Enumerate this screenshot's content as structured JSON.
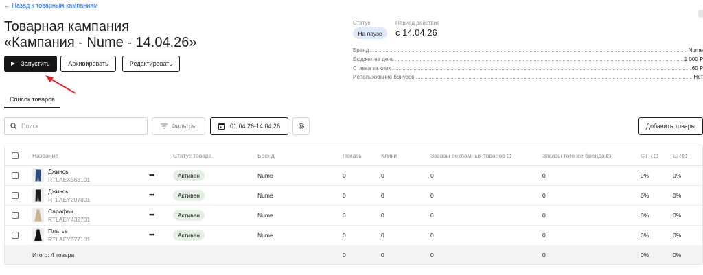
{
  "nav": {
    "back_label": "← Назад к товарным кампаниям"
  },
  "header": {
    "title_line1": "Товарная кампания",
    "title_line2": "«Кампания - Nume - 14.04.26»"
  },
  "actions": {
    "start_label": "Запустить",
    "archive_label": "Архивировать",
    "edit_label": "Редактировать"
  },
  "summary": {
    "status_label": "Статус",
    "status_value": "На паузе",
    "period_label": "Период действия",
    "period_value": "с 14.04.26",
    "rows": [
      {
        "label": "Бренд",
        "value": "Nume"
      },
      {
        "label": "Бюджет на день",
        "value": "1 000 ₽"
      },
      {
        "label": "Ставка за клик",
        "value": "60 ₽"
      },
      {
        "label": "Использование бонусов",
        "value": "Нет"
      }
    ]
  },
  "tabs": [
    {
      "label": "Список товаров",
      "active": true
    }
  ],
  "toolbar": {
    "search_placeholder": "Поиск",
    "filters_label": "Фильтры",
    "date_range": "01.04.26-14.04.26",
    "add_label": "Добавить товары"
  },
  "table": {
    "columns": [
      "Название",
      "Статус товара",
      "Бренд",
      "Показы",
      "Клики",
      "Заказы рекламных товаров",
      "Заказы того же бренда",
      "CTR",
      "CR"
    ],
    "rows": [
      {
        "name": "Джинсы",
        "sku": "RTLAEX563101",
        "status": "Активен",
        "brand": "Nume",
        "views": "0",
        "clicks": "0",
        "ads_orders": "0",
        "brand_orders": "0",
        "ctr": "0%",
        "cr": "0%",
        "thumb_color": "#2c4b7a"
      },
      {
        "name": "Джинсы",
        "sku": "RTLAEY207801",
        "status": "Активен",
        "brand": "Nume",
        "views": "0",
        "clicks": "0",
        "ads_orders": "0",
        "brand_orders": "0",
        "ctr": "0%",
        "cr": "0%",
        "thumb_color": "#1c1c1c"
      },
      {
        "name": "Сарафан",
        "sku": "RTLAEY432701",
        "status": "Активен",
        "brand": "Nume",
        "views": "0",
        "clicks": "0",
        "ads_orders": "0",
        "brand_orders": "0",
        "ctr": "0%",
        "cr": "0%",
        "thumb_color": "#c9b48a"
      },
      {
        "name": "Платье",
        "sku": "RTLAEY577101",
        "status": "Активен",
        "brand": "Nume",
        "views": "0",
        "clicks": "0",
        "ads_orders": "0",
        "brand_orders": "0",
        "ctr": "0%",
        "cr": "0%",
        "thumb_color": "#141414"
      }
    ],
    "total": {
      "label": "Итого: 4 товара",
      "views": "0",
      "clicks": "0",
      "ads_orders": "0",
      "brand_orders": "0",
      "ctr": "0%",
      "cr": "0%"
    }
  },
  "colors": {
    "accent_link": "#2a6fdb",
    "annotation_arrow": "#e02424",
    "status_badge_bg": "#dde8f8",
    "active_pill_bg": "#e3f0e3"
  },
  "icons": {
    "play": "play-icon",
    "search": "search-icon",
    "filter": "filter-icon",
    "calendar": "calendar-icon",
    "settings": "gear-icon",
    "info": "info-icon",
    "more": "more-dots-icon"
  }
}
